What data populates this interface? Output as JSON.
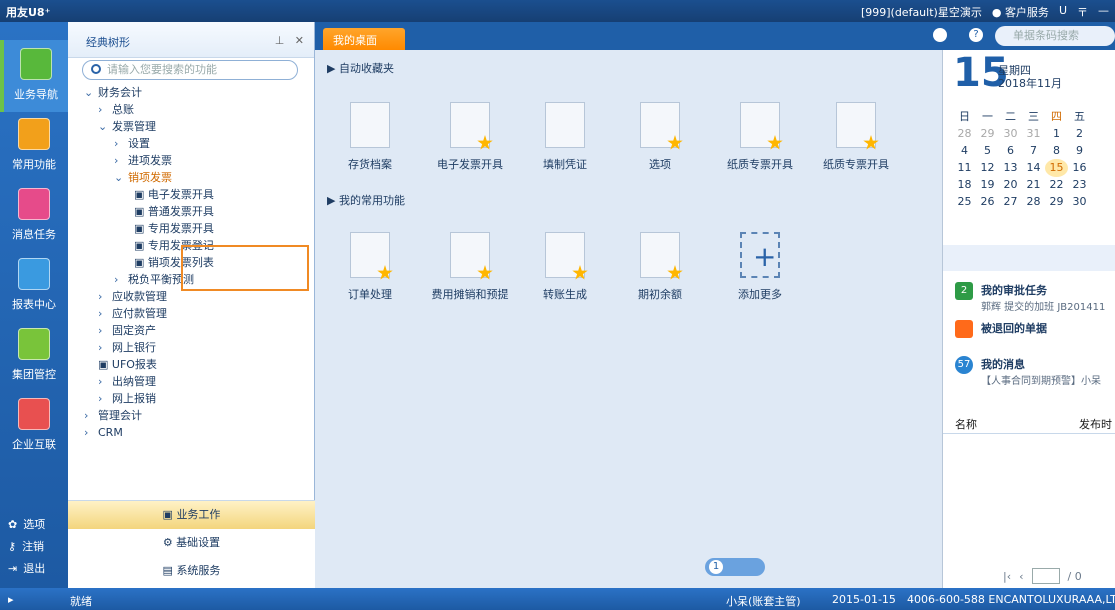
{
  "app": {
    "logo": "用友U8⁺"
  },
  "titlebar": {
    "account": "[999](default)星空演示",
    "service": "客户服务",
    "menu_u": "U",
    "menu_eq": "〒",
    "minimize": "—"
  },
  "leftnav": {
    "items": [
      {
        "label": "业务导航"
      },
      {
        "label": "常用功能"
      },
      {
        "label": "消息任务"
      },
      {
        "label": "报表中心"
      },
      {
        "label": "集团管控"
      },
      {
        "label": "企业互联"
      }
    ],
    "bottom": [
      {
        "label": "选项"
      },
      {
        "label": "注销"
      },
      {
        "label": "退出"
      }
    ]
  },
  "tree": {
    "title": "经典树形",
    "pin": "⊥",
    "close": "✕",
    "search_placeholder": "请输入您要搜索的功能",
    "items": [
      {
        "label": "财务会计",
        "indent": 1,
        "arrow": "⌄"
      },
      {
        "label": "总账",
        "indent": 2,
        "arrow": "›"
      },
      {
        "label": "发票管理",
        "indent": 2,
        "arrow": "⌄"
      },
      {
        "label": "设置",
        "indent": 3,
        "arrow": "›"
      },
      {
        "label": "进项发票",
        "indent": 3,
        "arrow": "›"
      },
      {
        "label": "销项发票",
        "indent": 3,
        "arrow": "⌄"
      },
      {
        "label": "电子发票开具",
        "indent": 4,
        "arrow": ""
      },
      {
        "label": "普通发票开具",
        "indent": 4,
        "arrow": ""
      },
      {
        "label": "专用发票开具",
        "indent": 4,
        "arrow": ""
      },
      {
        "label": "专用发票登记",
        "indent": 4,
        "arrow": ""
      },
      {
        "label": "销项发票列表",
        "indent": 4,
        "arrow": ""
      },
      {
        "label": "税负平衡预测",
        "indent": 3,
        "arrow": "›"
      },
      {
        "label": "应收款管理",
        "indent": 2,
        "arrow": "›"
      },
      {
        "label": "应付款管理",
        "indent": 2,
        "arrow": "›"
      },
      {
        "label": "固定资产",
        "indent": 2,
        "arrow": "›"
      },
      {
        "label": "网上银行",
        "indent": 2,
        "arrow": "›"
      },
      {
        "label": "UFO报表",
        "indent": 2,
        "arrow": ""
      },
      {
        "label": "出纳管理",
        "indent": 2,
        "arrow": "›"
      },
      {
        "label": "网上报销",
        "indent": 2,
        "arrow": "›"
      },
      {
        "label": "管理会计",
        "indent": 1,
        "arrow": "›"
      },
      {
        "label": "CRM",
        "indent": 1,
        "arrow": "›"
      }
    ],
    "bottom": [
      {
        "label": "业务工作",
        "selected": true
      },
      {
        "label": "基础设置",
        "selected": false
      },
      {
        "label": "系统服务",
        "selected": false
      }
    ]
  },
  "tabs": [
    {
      "label": "我的桌面"
    }
  ],
  "topsearch": {
    "placeholder": "单据条码搜索"
  },
  "main": {
    "auto_fav_title": "自动收藏夹",
    "auto_fav": [
      {
        "label": "存货档案"
      },
      {
        "label": "电子发票开具"
      },
      {
        "label": "填制凭证"
      },
      {
        "label": "选项"
      },
      {
        "label": "纸质专票开具"
      },
      {
        "label": "纸质专票开具"
      }
    ],
    "common_title": "我的常用功能",
    "common": [
      {
        "label": "订单处理"
      },
      {
        "label": "费用摊销和预提"
      },
      {
        "label": "转账生成"
      },
      {
        "label": "期初余额"
      },
      {
        "label": "添加更多"
      }
    ],
    "pager": "1"
  },
  "calendar": {
    "day": "15",
    "weekday": "星期四",
    "year_month": "2018年11月",
    "headers": [
      "日",
      "一",
      "二",
      "三",
      "四",
      "五"
    ],
    "rows": [
      [
        "28",
        "29",
        "30",
        "31",
        "1",
        "2"
      ],
      [
        "4",
        "5",
        "6",
        "7",
        "8",
        "9"
      ],
      [
        "11",
        "12",
        "13",
        "14",
        "15",
        "16"
      ],
      [
        "18",
        "19",
        "20",
        "21",
        "22",
        "23"
      ],
      [
        "25",
        "26",
        "27",
        "28",
        "29",
        "30"
      ]
    ]
  },
  "tasks": [
    {
      "title": "我的审批任务",
      "sub": "郭辉 提交的加班 JB201411",
      "badge": "2"
    },
    {
      "title": "被退回的单据",
      "sub": "",
      "badge": ""
    },
    {
      "title": "我的消息",
      "sub": "【人事合同到期预警】小呆",
      "badge": "57"
    }
  ],
  "table": {
    "col1": "名称",
    "col2": "发布时"
  },
  "table_pager": {
    "page": "/ 0"
  },
  "status": {
    "ready": "就绪",
    "user": "小呆(账套主管)",
    "date": "2015-01-15",
    "company": "4006-600-588 ENCANTOLUXURAAA,LTD"
  },
  "colors": {
    "brand": "#1f5fa8",
    "accent": "#ff8a00",
    "highlight": "#f08a24"
  }
}
